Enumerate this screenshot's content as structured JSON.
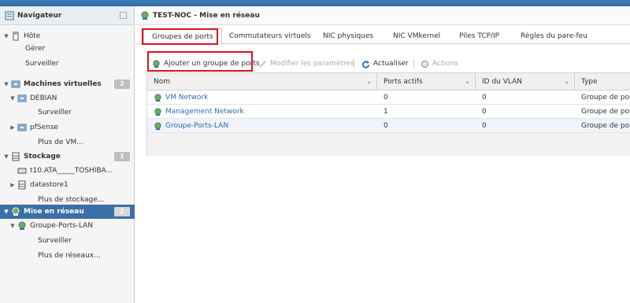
{
  "navigator": {
    "title": "Navigateur",
    "items": [
      {
        "label": "Hôte",
        "badge": null
      },
      {
        "label": "Gérer",
        "badge": null
      },
      {
        "label": "Surveiller",
        "badge": null
      },
      {
        "label": "Machines virtuelles",
        "badge": "2"
      },
      {
        "label": "DEBIAN",
        "badge": null
      },
      {
        "label": "Surveiller",
        "badge": null
      },
      {
        "label": "pfSense",
        "badge": null
      },
      {
        "label": "Plus de VM...",
        "badge": null
      },
      {
        "label": "Stockage",
        "badge": "1"
      },
      {
        "label": "t10.ATA_____TOSHIBA...",
        "badge": null
      },
      {
        "label": "datastore1",
        "badge": null
      },
      {
        "label": "Plus de stockage...",
        "badge": null
      },
      {
        "label": "Mise en réseau",
        "badge": "2"
      },
      {
        "label": "Groupe-Ports-LAN",
        "badge": null
      },
      {
        "label": "Surveiller",
        "badge": null
      },
      {
        "label": "Plus de réseaux...",
        "badge": null
      }
    ]
  },
  "main": {
    "title": "TEST-NOC - Mise en réseau",
    "tabs": [
      {
        "label": "Groupes de ports"
      },
      {
        "label": "Commutateurs virtuels"
      },
      {
        "label": "NIC physiques"
      },
      {
        "label": "NIC VMkernel"
      },
      {
        "label": "Piles TCP/IP"
      },
      {
        "label": "Règles du pare-feu"
      }
    ],
    "toolbar": {
      "add": "Ajouter un groupe de ports",
      "edit": "Modifier les paramètres",
      "refresh": "Actualiser",
      "actions": "Actions"
    },
    "table": {
      "headers": [
        "Nom",
        "Ports actifs",
        "ID du VLAN",
        "Type"
      ],
      "rows": [
        {
          "name": "VM Network",
          "ports": "0",
          "vlan": "0",
          "type": "Groupe de ports"
        },
        {
          "name": "Management Network",
          "ports": "1",
          "vlan": "0",
          "type": "Groupe de ports"
        },
        {
          "name": "Groupe-Ports-LAN",
          "ports": "0",
          "vlan": "0",
          "type": "Groupe de ports"
        }
      ]
    }
  },
  "colors": {
    "selection": "#3b6fa5",
    "highlight": "#d9141f",
    "link": "#2c6cb0"
  }
}
